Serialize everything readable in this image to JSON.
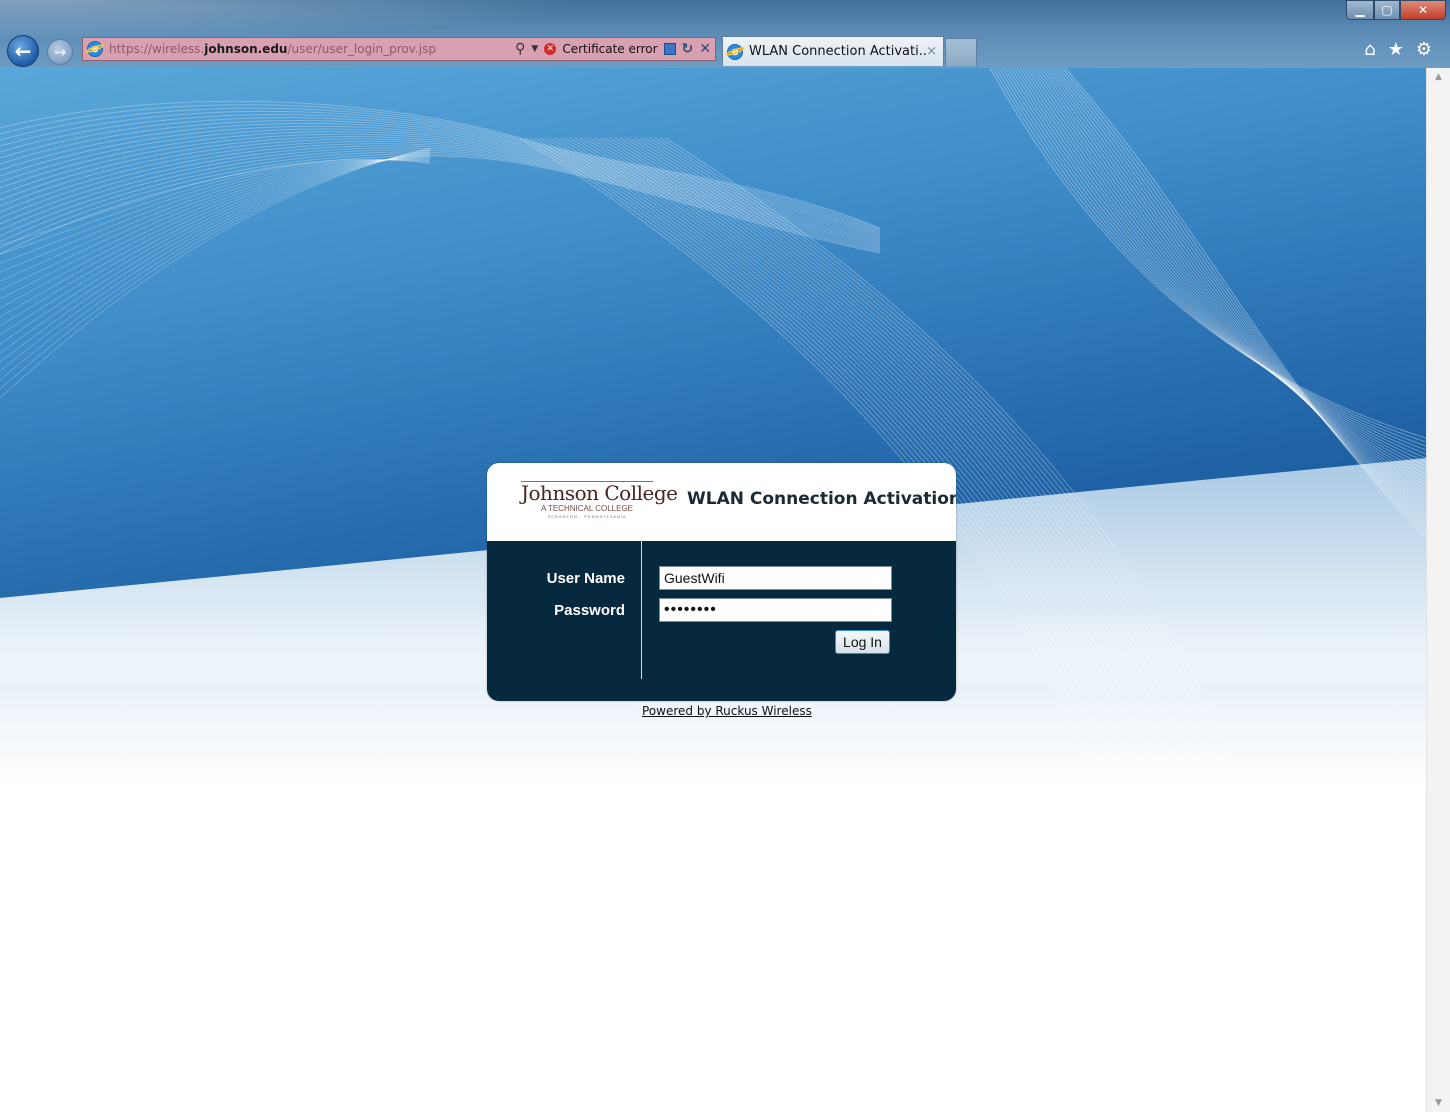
{
  "browser": {
    "address": {
      "url_prefix": "https://wireless.",
      "url_domain": "johnson.edu",
      "url_path": "/user/user_login_prov.jsp",
      "cert_error_label": "Certificate error"
    },
    "tab": {
      "label": "WLAN Connection Activati...",
      "close_glyph": "×"
    },
    "icons": {
      "back": "back-arrow-icon",
      "forward": "forward-arrow-icon",
      "search": "search-icon",
      "home": "home-icon",
      "favorites": "star-icon",
      "tools": "gear-icon"
    }
  },
  "login": {
    "logo": {
      "name": "Johnson College",
      "tagline": "A TECHNICAL COLLEGE",
      "location": "SCRANTON · PENNSYLVANIA"
    },
    "title": "WLAN Connection Activation",
    "username_label": "User Name",
    "password_label": "Password",
    "username_value": "GuestWifi",
    "password_value": "xxxxxxxx",
    "login_button": "Log In"
  },
  "footer": {
    "powered_by": "Powered by Ruckus Wireless"
  },
  "colors": {
    "card_body": "#06293d",
    "address_bar_error": "#d9a0b2",
    "background_blue": "#1c6fb0"
  }
}
